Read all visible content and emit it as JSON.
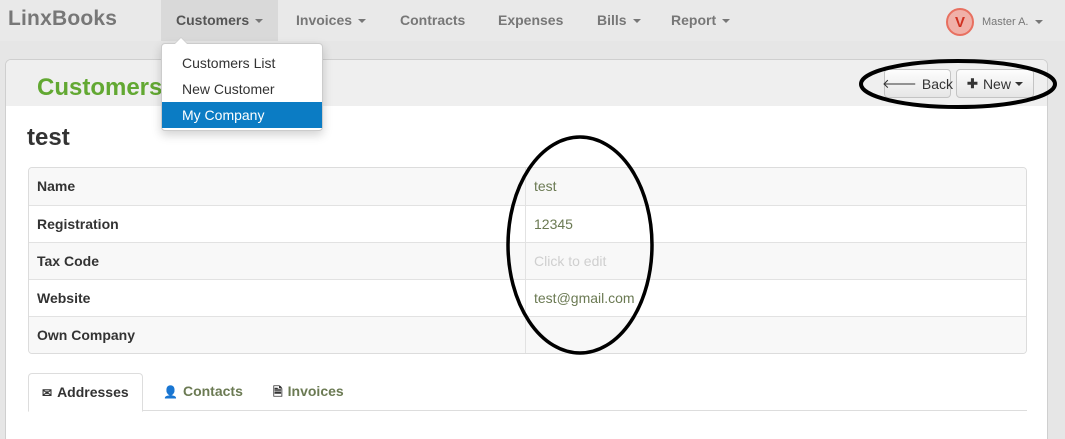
{
  "navbar": {
    "brand": "LinxBooks",
    "items": [
      {
        "label": "Customers",
        "has_caret": true,
        "active": true
      },
      {
        "label": "Invoices",
        "has_caret": true
      },
      {
        "label": "Contracts",
        "has_caret": false
      },
      {
        "label": "Expenses",
        "has_caret": false
      },
      {
        "label": "Bills",
        "has_caret": true
      },
      {
        "label": "Report",
        "has_caret": true
      }
    ],
    "user": {
      "avatar_letter": "V",
      "name": "Master A."
    }
  },
  "customers_menu": {
    "items": [
      {
        "label": "Customers List"
      },
      {
        "label": "New Customer"
      },
      {
        "label": "My Company",
        "selected": true
      }
    ]
  },
  "header": {
    "title": "Customers",
    "back_label": "Back",
    "new_label": "New",
    "back_icon": "arrow-left-icon",
    "new_icon": "plus-icon"
  },
  "record": {
    "title": "test",
    "fields": [
      {
        "label": "Name",
        "value": "test"
      },
      {
        "label": "Registration",
        "value": "12345"
      },
      {
        "label": "Tax Code",
        "value": "Click to edit",
        "is_placeholder": true
      },
      {
        "label": "Website",
        "value": "test@gmail.com"
      },
      {
        "label": "Own Company",
        "value": ""
      }
    ]
  },
  "tabs": [
    {
      "label": "Addresses",
      "icon": "envelope-icon",
      "active": true
    },
    {
      "label": "Contacts",
      "icon": "user-icon"
    },
    {
      "label": "Invoices",
      "icon": "file-icon"
    }
  ],
  "colors": {
    "title_green": "#62a832",
    "menu_highlight": "#0b7cc4",
    "value_text": "#6b7a53"
  }
}
